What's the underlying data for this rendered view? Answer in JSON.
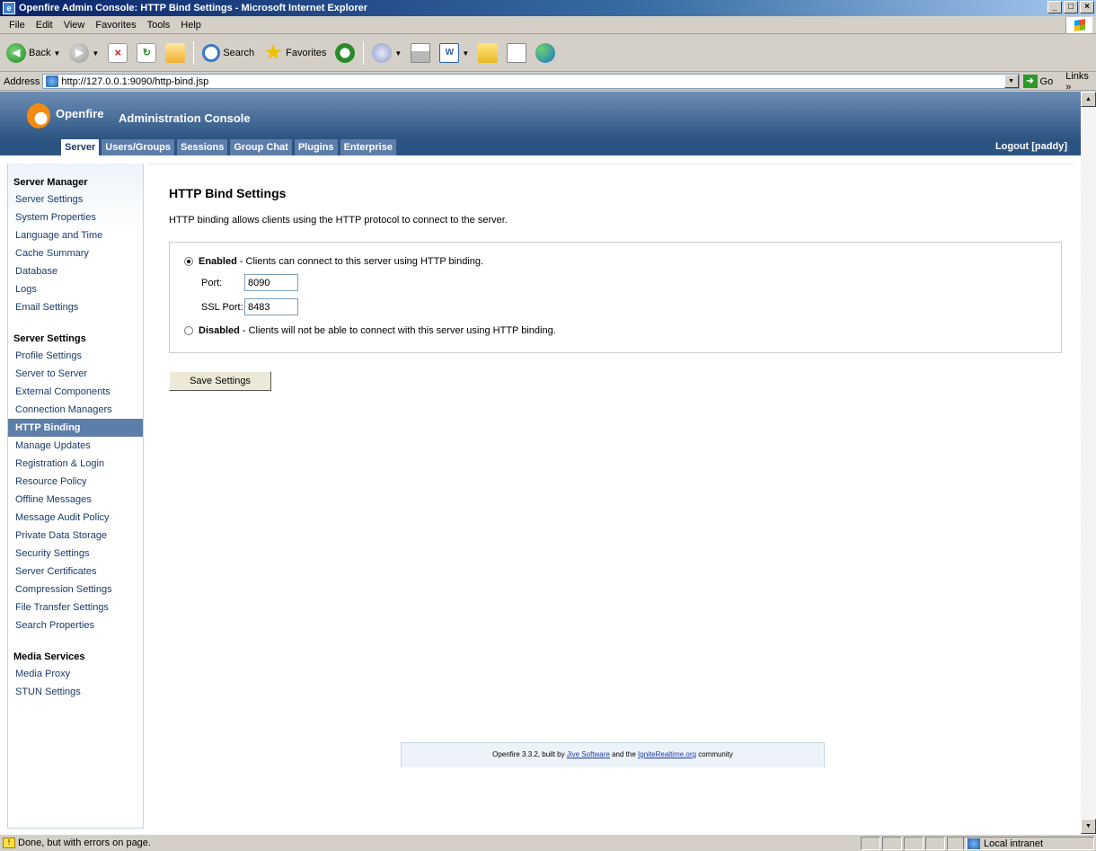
{
  "window": {
    "title": "Openfire Admin Console: HTTP Bind Settings - Microsoft Internet Explorer"
  },
  "menu": [
    "File",
    "Edit",
    "View",
    "Favorites",
    "Tools",
    "Help"
  ],
  "toolbar": {
    "back": "Back",
    "search": "Search",
    "favorites": "Favorites"
  },
  "address": {
    "label": "Address",
    "url": "http://127.0.0.1:9090/http-bind.jsp",
    "go": "Go",
    "links": "Links"
  },
  "header": {
    "brand": "Openfire",
    "console": "Administration Console",
    "tabs": [
      "Server",
      "Users/Groups",
      "Sessions",
      "Group Chat",
      "Plugins",
      "Enterprise"
    ],
    "active_tab": "Server",
    "logout": "Logout [paddy]"
  },
  "sidebar": {
    "sections": [
      {
        "title": "Server Manager",
        "items": [
          "Server Settings",
          "System Properties",
          "Language and Time",
          "Cache Summary",
          "Database",
          "Logs",
          "Email Settings"
        ]
      },
      {
        "title": "Server Settings",
        "items": [
          "Profile Settings",
          "Server to Server",
          "External Components",
          "Connection Managers",
          "HTTP Binding",
          "Manage Updates",
          "Registration & Login",
          "Resource Policy",
          "Offline Messages",
          "Message Audit Policy",
          "Private Data Storage",
          "Security Settings",
          "Server Certificates",
          "Compression Settings",
          "File Transfer Settings",
          "Search Properties"
        ]
      },
      {
        "title": "Media Services",
        "items": [
          "Media Proxy",
          "STUN Settings"
        ]
      }
    ],
    "active_item": "HTTP Binding"
  },
  "main": {
    "title": "HTTP Bind Settings",
    "intro": "HTTP binding allows clients using the HTTP protocol to connect to the server.",
    "enabled_label": "Enabled",
    "enabled_desc": "- Clients can connect to this server using HTTP binding.",
    "port_label": "Port:",
    "port_value": "8090",
    "ssl_port_label": "SSL Port:",
    "ssl_port_value": "8483",
    "disabled_label": "Disabled",
    "disabled_desc": "- Clients will not be able to connect with this server using HTTP binding.",
    "save_button": "Save Settings"
  },
  "footer": {
    "prefix": "Openfire 3.3.2, built by",
    "link1": "Jive Software",
    "middle": "and the",
    "link2": "IgniteRealtime.org",
    "suffix": "community"
  },
  "status": {
    "message": "Done, but with errors on page.",
    "zone": "Local intranet"
  }
}
